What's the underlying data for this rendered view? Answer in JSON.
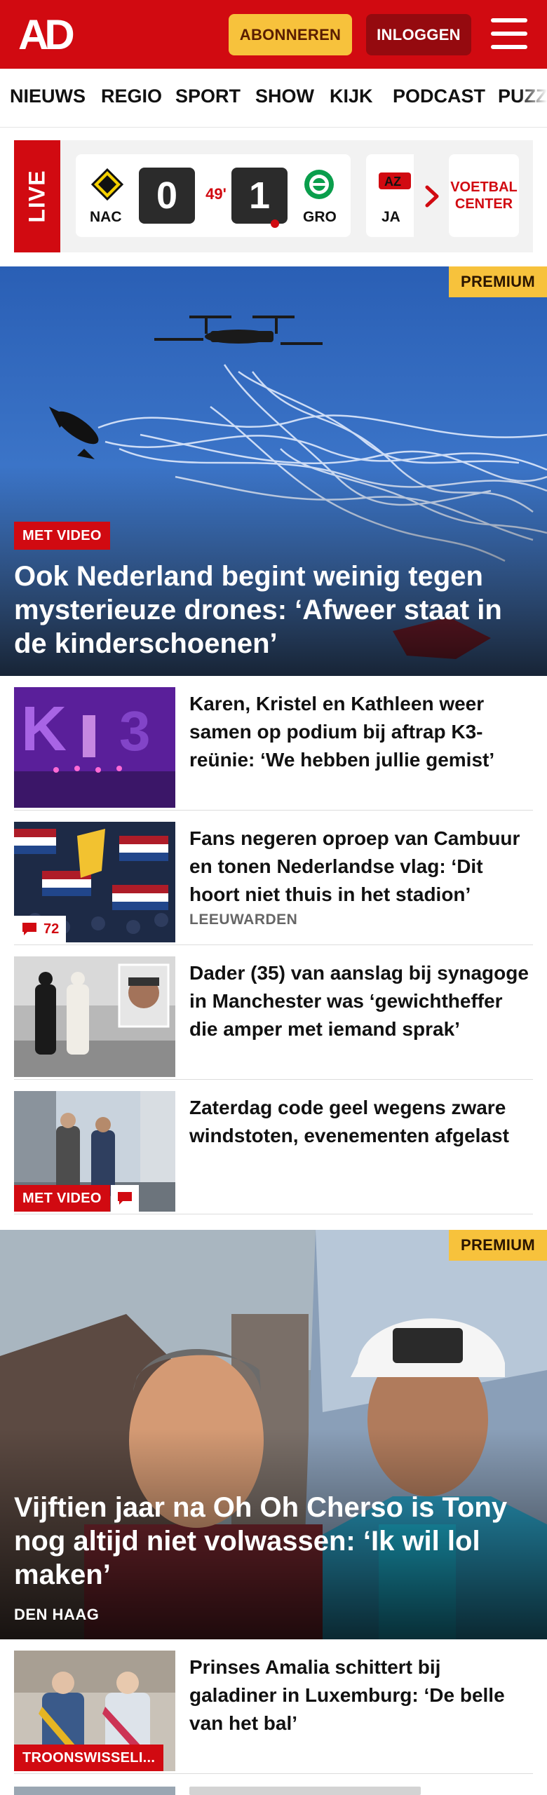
{
  "header": {
    "logo_text": "AD",
    "subscribe_label": "ABONNEREN",
    "login_label": "INLOGGEN",
    "brand_red": "#d10a11",
    "accent_yellow": "#f7c23c"
  },
  "nav": {
    "items": [
      "NIEUWS",
      "REGIO",
      "SPORT",
      "SHOW",
      "KIJK",
      "PODCAST",
      "PUZZ"
    ]
  },
  "live": {
    "label": "LIVE",
    "match": {
      "home_team": "NAC",
      "away_team": "GRO",
      "home_score": "0",
      "away_score": "1",
      "minute": "49'"
    },
    "next_team_partial": "JA",
    "voetbal_center_label": "VOETBAL CENTER"
  },
  "hero1": {
    "premium_label": "PREMIUM",
    "badge": "MET VIDEO",
    "title": "Ook Nederland begint weinig tegen mysterieuze drones: ‘Afweer staat in de kinderschoenen’"
  },
  "articles": [
    {
      "title": "Karen, Kristel en Kathleen weer samen op podium bij aftrap K3-reünie: ‘We hebben jullie gemist’"
    },
    {
      "title": "Fans negeren oproep van Cambuur en tonen Nederlandse vlag: ‘Dit hoort niet thuis in het stadion’",
      "location": "LEEUWARDEN",
      "comments": "72"
    },
    {
      "title": "Dader (35) van aanslag bij synagoge in Manchester was ‘gewichtheffer die amper met iemand sprak’"
    },
    {
      "title": "Zaterdag code geel wegens zware windstoten, evenementen afgelast",
      "badge": "MET VIDEO"
    }
  ],
  "hero2": {
    "premium_label": "PREMIUM",
    "title": "Vijftien jaar na Oh Oh Cherso is Tony nog altijd niet volwassen: ‘Ik wil lol maken’",
    "location": "DEN HAAG"
  },
  "article5": {
    "title": "Prinses Amalia schittert bij galadiner in Luxemburg: ‘De belle van het bal’",
    "badge": "TROONSWISSELI..."
  }
}
